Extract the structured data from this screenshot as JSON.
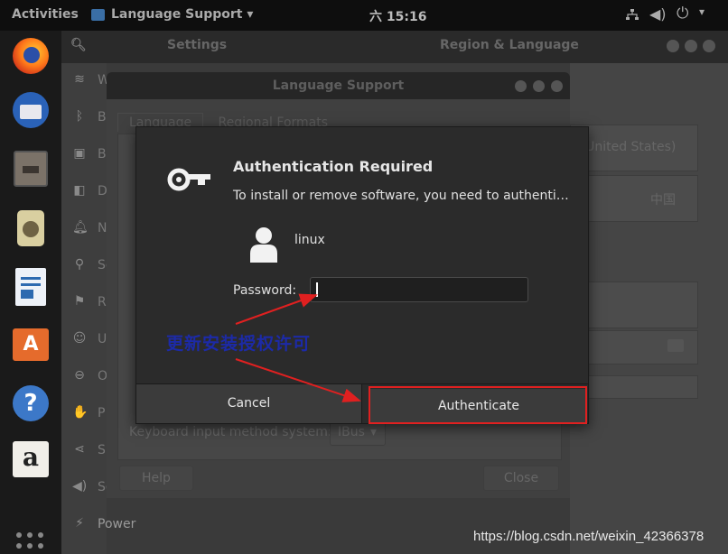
{
  "topbar": {
    "activities": "Activities",
    "app_menu": "Language Support",
    "clock": "六 15:16"
  },
  "dock": {
    "items": [
      {
        "name": "firefox-icon"
      },
      {
        "name": "thunderbird-icon"
      },
      {
        "name": "files-icon"
      },
      {
        "name": "rhythmbox-icon"
      },
      {
        "name": "writer-icon"
      },
      {
        "name": "software-icon"
      },
      {
        "name": "help-icon"
      },
      {
        "name": "amazon-icon"
      }
    ]
  },
  "settings": {
    "title": "Settings",
    "panel_title": "Region & Language",
    "sidebar": [
      {
        "label": "W",
        "icon": "wifi-icon"
      },
      {
        "label": "B",
        "icon": "bluetooth-icon"
      },
      {
        "label": "B",
        "icon": "background-icon"
      },
      {
        "label": "D",
        "icon": "dock-icon"
      },
      {
        "label": "N",
        "icon": "notifications-icon"
      },
      {
        "label": "Se",
        "icon": "search-icon"
      },
      {
        "label": "R",
        "icon": "region-icon"
      },
      {
        "label": "U",
        "icon": "universal-access-icon"
      },
      {
        "label": "O",
        "icon": "online-accounts-icon"
      },
      {
        "label": "P",
        "icon": "privacy-icon"
      },
      {
        "label": "Sh",
        "icon": "sharing-icon"
      },
      {
        "label": "So",
        "icon": "sound-icon"
      },
      {
        "label": "Power",
        "icon": "power-icon"
      }
    ],
    "language_value": "sh (United States)",
    "formats_value": "中国"
  },
  "language_support": {
    "title": "Language Support",
    "tabs": [
      "Language",
      "Regional Formats"
    ],
    "keyboard_label": "Keyboard input method system:",
    "keyboard_value": "IBus",
    "help_label": "Help",
    "close_label": "Close"
  },
  "auth": {
    "title": "Authentication Required",
    "message": "To install or remove software, you need to authenti…",
    "user": "linux",
    "password_label": "Password:",
    "password_value": "",
    "cancel_label": "Cancel",
    "authenticate_label": "Authenticate"
  },
  "annotation": {
    "text": "更新安装授权许可",
    "color": "#1c2aa8",
    "arrow_color": "#e02020"
  },
  "watermark": "https://blog.csdn.net/weixin_42366378"
}
